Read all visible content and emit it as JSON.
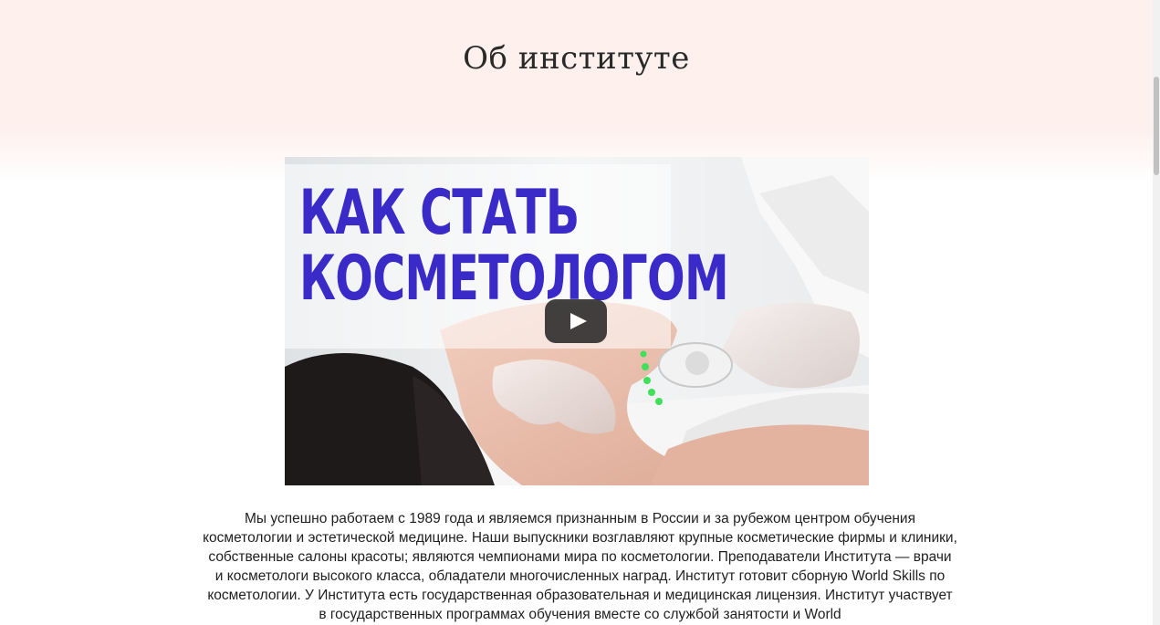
{
  "section": {
    "title": "Об институте"
  },
  "video": {
    "headline_line1": "КАК СТАТЬ",
    "headline_line2": "КОСМЕТОЛОГОМ",
    "play_icon": "play-icon",
    "headline_color": "#3a2bc8"
  },
  "about": {
    "text": "Мы успешно работаем с 1989 года и являемся признанным в России и за рубежом центром обучения косметологии и эстетической медицине. Наши выпускники возглавляют крупные косметические фирмы и клиники, собственные салоны красоты; являются чемпионами мира по косметологии. Преподаватели Института — врачи и косметологи высокого класса, обладатели многочисленных наград. Институт готовит сборную World Skills по косметологии. У Института есть государственная образовательная и медицинская лицензия. Институт участвует в государственных программах обучения вместе со службой занятости и World"
  },
  "colors": {
    "top_band": "#fdf0ed",
    "accent": "#3a2bc8"
  }
}
